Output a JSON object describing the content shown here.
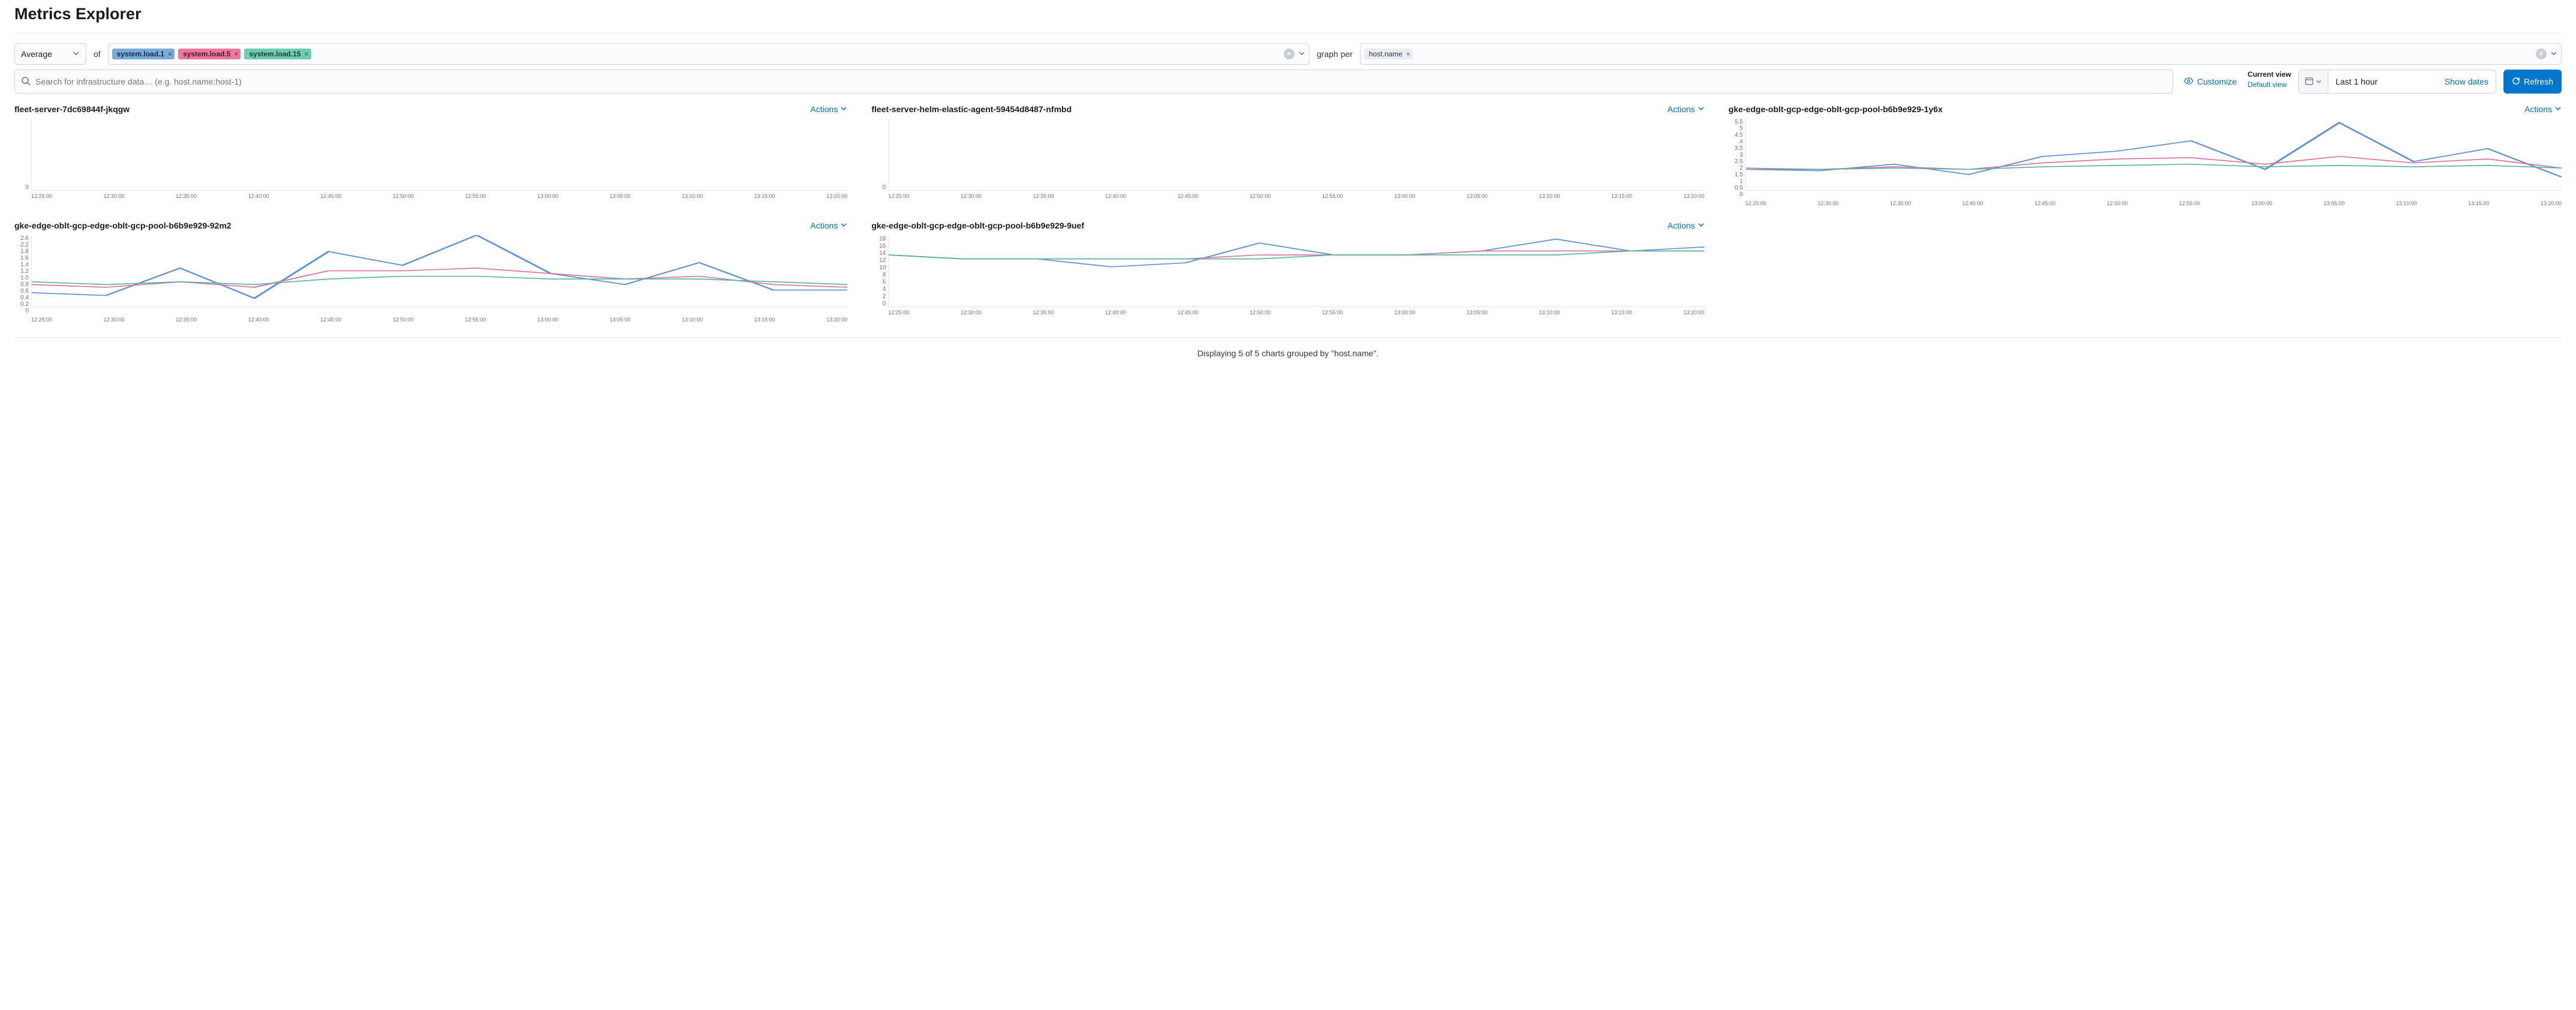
{
  "page_title": "Metrics Explorer",
  "toolbar": {
    "aggregation": "Average",
    "of_label": "of",
    "metrics": [
      {
        "label": "system.load.1",
        "color": "blue"
      },
      {
        "label": "system.load.5",
        "color": "pink"
      },
      {
        "label": "system.load.15",
        "color": "green"
      }
    ],
    "graph_per_label": "graph per",
    "group_by_tags": [
      "host.name"
    ]
  },
  "search": {
    "placeholder": "Search for infrastructure data… (e.g. host.name:host-1)"
  },
  "customize_label": "Customize",
  "view": {
    "current_label": "Current view",
    "default_label": "Default view"
  },
  "date_picker": {
    "range": "Last 1 hour",
    "show_dates": "Show dates"
  },
  "refresh_label": "Refresh",
  "actions_label": "Actions",
  "chart_colors": {
    "load1": "#5c8fd6",
    "load5": "#d6719e",
    "load15": "#54b399"
  },
  "x_ticks": [
    "12:25:00",
    "12:30:00",
    "12:35:00",
    "12:40:00",
    "12:45:00",
    "12:50:00",
    "12:55:00",
    "13:00:00",
    "13:05:00",
    "13:10:00",
    "13:15:00",
    "13:20:00"
  ],
  "footer": "Displaying 5 of 5 charts grouped by \"host.name\".",
  "chart_data": [
    {
      "title": "fleet-server-7dc69844f-jkqgw",
      "type": "line",
      "ylim": [
        0,
        0
      ],
      "y_ticks": [
        "0"
      ],
      "categories": [
        "12:25:00",
        "12:30:00",
        "12:35:00",
        "12:40:00",
        "12:45:00",
        "12:50:00",
        "12:55:00",
        "13:00:00",
        "13:05:00",
        "13:10:00",
        "13:15:00",
        "13:20:00"
      ],
      "series": [
        {
          "name": "system.load.1",
          "values": [
            null,
            null,
            null,
            null,
            null,
            null,
            null,
            null,
            null,
            null,
            null,
            null
          ]
        },
        {
          "name": "system.load.5",
          "values": [
            null,
            null,
            null,
            null,
            null,
            null,
            null,
            null,
            null,
            null,
            null,
            null
          ]
        },
        {
          "name": "system.load.15",
          "values": [
            null,
            null,
            null,
            null,
            null,
            null,
            null,
            null,
            null,
            null,
            null,
            null
          ]
        }
      ]
    },
    {
      "title": "fleet-server-helm-elastic-agent-59454d8487-nfmbd",
      "type": "line",
      "ylim": [
        0,
        0
      ],
      "y_ticks": [
        "0"
      ],
      "categories": [
        "12:25:00",
        "12:30:00",
        "12:35:00",
        "12:40:00",
        "12:45:00",
        "12:50:00",
        "12:55:00",
        "13:00:00",
        "13:05:00",
        "13:10:00",
        "13:15:00",
        "13:20:00"
      ],
      "series": [
        {
          "name": "system.load.1",
          "values": [
            null,
            null,
            null,
            null,
            null,
            null,
            null,
            null,
            null,
            null,
            null,
            null
          ]
        },
        {
          "name": "system.load.5",
          "values": [
            null,
            null,
            null,
            null,
            null,
            null,
            null,
            null,
            null,
            null,
            null,
            null
          ]
        },
        {
          "name": "system.load.15",
          "values": [
            null,
            null,
            null,
            null,
            null,
            null,
            null,
            null,
            null,
            null,
            null,
            null
          ]
        }
      ]
    },
    {
      "title": "gke-edge-oblt-gcp-edge-oblt-gcp-pool-b6b9e929-1y6x",
      "type": "line",
      "ylim": [
        0,
        5.5
      ],
      "y_ticks": [
        "0",
        "0.5",
        "1",
        "1.5",
        "2",
        "2.5",
        "3",
        "3.5",
        "4",
        "4.5",
        "5",
        "5.5"
      ],
      "categories": [
        "12:25:00",
        "12:30:00",
        "12:35:00",
        "12:40:00",
        "12:45:00",
        "12:50:00",
        "12:55:00",
        "13:00:00",
        "13:05:00",
        "13:10:00",
        "13:15:00",
        "13:20:00"
      ],
      "series": [
        {
          "name": "system.load.1",
          "values": [
            1.6,
            1.5,
            2.0,
            1.2,
            2.6,
            3.0,
            3.8,
            1.6,
            5.2,
            2.2,
            3.2,
            1.0
          ]
        },
        {
          "name": "system.load.5",
          "values": [
            1.7,
            1.6,
            1.8,
            1.6,
            2.1,
            2.4,
            2.5,
            2.0,
            2.6,
            2.1,
            2.4,
            1.7
          ]
        },
        {
          "name": "system.load.15",
          "values": [
            1.6,
            1.6,
            1.7,
            1.6,
            1.8,
            1.9,
            2.0,
            1.8,
            1.9,
            1.8,
            1.9,
            1.7
          ]
        }
      ]
    },
    {
      "title": "gke-edge-oblt-gcp-edge-oblt-gcp-pool-b6b9e929-92m2",
      "type": "line",
      "ylim": [
        0,
        2.6
      ],
      "y_ticks": [
        "0",
        "0.2",
        "0.4",
        "0.6",
        "0.8",
        "1.0",
        "1.2",
        "1.4",
        "1.6",
        "1.8",
        "2.2",
        "2.6"
      ],
      "categories": [
        "12:25:00",
        "12:30:00",
        "12:35:00",
        "12:40:00",
        "12:45:00",
        "12:50:00",
        "12:55:00",
        "13:00:00",
        "13:05:00",
        "13:10:00",
        "13:15:00",
        "13:20:00"
      ],
      "series": [
        {
          "name": "system.load.1",
          "values": [
            0.5,
            0.4,
            1.4,
            0.3,
            2.0,
            1.5,
            2.6,
            1.2,
            0.8,
            1.6,
            0.6,
            0.6
          ]
        },
        {
          "name": "system.load.5",
          "values": [
            0.8,
            0.7,
            0.9,
            0.7,
            1.3,
            1.3,
            1.4,
            1.2,
            1.0,
            1.1,
            0.8,
            0.7
          ]
        },
        {
          "name": "system.load.15",
          "values": [
            0.9,
            0.8,
            0.9,
            0.8,
            1.0,
            1.1,
            1.1,
            1.0,
            1.0,
            1.0,
            0.9,
            0.8
          ]
        }
      ]
    },
    {
      "title": "gke-edge-oblt-gcp-edge-oblt-gcp-pool-b6b9e929-9uef",
      "type": "line",
      "ylim": [
        0,
        18
      ],
      "y_ticks": [
        "0",
        "2",
        "4",
        "6",
        "8",
        "10",
        "12",
        "14",
        "16",
        "18"
      ],
      "categories": [
        "12:25:00",
        "12:30:00",
        "12:35:00",
        "12:40:00",
        "12:45:00",
        "12:50:00",
        "12:55:00",
        "13:00:00",
        "13:05:00",
        "13:10:00",
        "13:15:00",
        "13:20:00"
      ],
      "series": [
        {
          "name": "system.load.1",
          "values": [
            13,
            12,
            12,
            10,
            11,
            16,
            13,
            13,
            14,
            17,
            14,
            15
          ]
        },
        {
          "name": "system.load.5",
          "values": [
            13,
            12,
            12,
            12,
            12,
            13,
            13,
            13,
            14,
            14,
            14,
            14
          ]
        },
        {
          "name": "system.load.15",
          "values": [
            13,
            12,
            12,
            12,
            12,
            12,
            13,
            13,
            13,
            13,
            14,
            14
          ]
        }
      ]
    }
  ]
}
